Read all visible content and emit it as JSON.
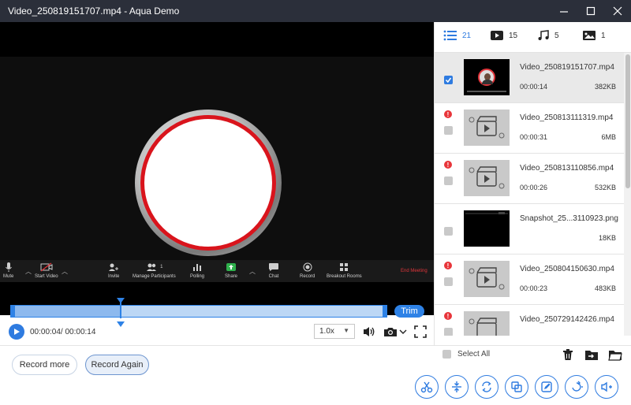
{
  "window": {
    "title": "Video_250819151707.mp4  -  Aqua Demo",
    "controls": [
      "minimize-icon",
      "maximize-icon",
      "close-icon"
    ]
  },
  "meeting_toolbar": {
    "items": [
      "Mute",
      "Start Video",
      "Invite",
      "Manage Participants",
      "Polling",
      "Share",
      "Chat",
      "Record",
      "Breakout Rooms"
    ],
    "participants_count": "1",
    "end_label": "End Meeting"
  },
  "player": {
    "trim_label": "Trim",
    "time": "00:00:04/ 00:00:14",
    "speed": "1.0x",
    "progress_fraction": 0.29
  },
  "bottom": {
    "record_more": "Record more",
    "record_again": "Record Again",
    "tools": [
      "scissors-icon",
      "compress-icon",
      "rotate-icon",
      "merge-icon",
      "edit-icon",
      "convert-icon",
      "volume-plus-icon"
    ]
  },
  "tabs": [
    {
      "icon": "list-icon",
      "count": "21"
    },
    {
      "icon": "video-icon",
      "count": "15"
    },
    {
      "icon": "music-icon",
      "count": "5"
    },
    {
      "icon": "image-icon",
      "count": "1"
    }
  ],
  "files": [
    {
      "name": "Video_250819151707.mp4",
      "duration": "00:00:14",
      "size": "382KB",
      "checked": true,
      "warning": false,
      "thumb": "video-frame"
    },
    {
      "name": "Video_250813111319.mp4",
      "duration": "00:00:31",
      "size": "6MB",
      "checked": false,
      "warning": true,
      "thumb": "placeholder"
    },
    {
      "name": "Video_250813110856.mp4",
      "duration": "00:00:26",
      "size": "532KB",
      "checked": false,
      "warning": true,
      "thumb": "placeholder"
    },
    {
      "name": "Snapshot_25...3110923.png",
      "duration": "",
      "size": "18KB",
      "checked": false,
      "warning": false,
      "thumb": "dark"
    },
    {
      "name": "Video_250804150630.mp4",
      "duration": "00:00:23",
      "size": "483KB",
      "checked": false,
      "warning": true,
      "thumb": "placeholder"
    },
    {
      "name": "Video_250729142426.mp4",
      "duration": "",
      "size": "",
      "checked": false,
      "warning": true,
      "thumb": "placeholder"
    }
  ],
  "list_footer": {
    "select_all": "Select All"
  }
}
